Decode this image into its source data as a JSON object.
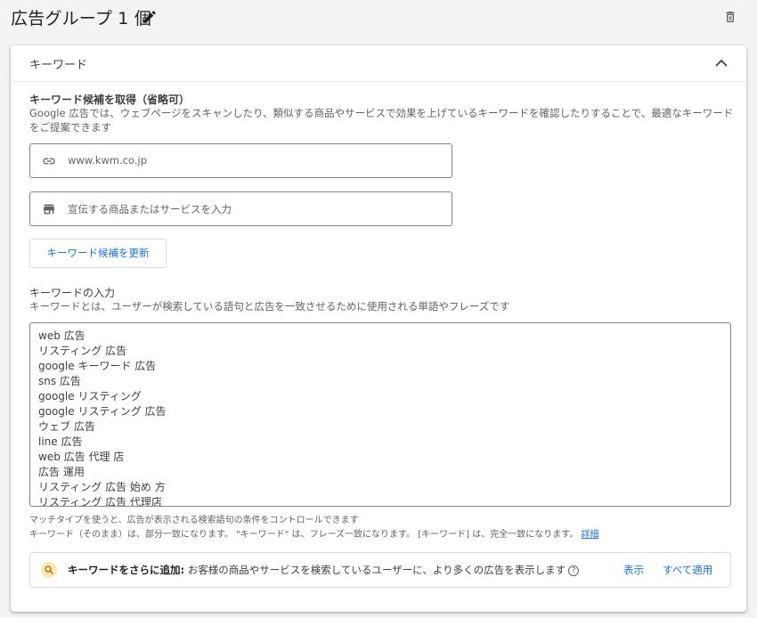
{
  "header": {
    "title": "広告グループ 1 個"
  },
  "keyword_card": {
    "header_label": "キーワード",
    "suggest": {
      "title": "キーワード候補を取得（省略可）",
      "description_line1": "Google 広告では、ウェブページをスキャンしたり、類似する商品やサービスで効果を上げているキーワードを確認したりすることで、最適なキーワード",
      "description_line2": "をご提案できます",
      "url_value": "www.kwm.co.jp",
      "product_placeholder": "宣伝する商品またはサービスを入力",
      "refresh_button": "キーワード候補を更新"
    },
    "input": {
      "title": "キーワードの入力",
      "description": "キーワードとは、ユーザーが検索している語句と広告を一致させるために使用される単語やフレーズです",
      "keywords": [
        "web 広告",
        "リスティング 広告",
        "google キーワード 広告",
        "sns 広告",
        "google リスティング",
        "google リスティング 広告",
        "ウェブ 広告",
        "line 広告",
        "web 広告 代理 店",
        "広告 運用",
        "リスティング 広告 始め 方",
        "リスティング 広告 代理店"
      ]
    },
    "match_hint": {
      "line1": "マッチタイプを使うと、広告が表示される検索語句の条件をコントロールできます",
      "line2": "キーワード（そのまま）は、部分一致になります。 \"キーワード\" は、フレーズ一致になります。 [キーワード] は、完全一致になります。",
      "link": "詳細"
    },
    "banner": {
      "bold": "キーワードをさらに追加:",
      "text": " お客様の商品やサービスを検索しているユーザーに、より多くの広告を表示します",
      "help": "?",
      "show": "表示",
      "apply_all": "すべて適用"
    }
  }
}
